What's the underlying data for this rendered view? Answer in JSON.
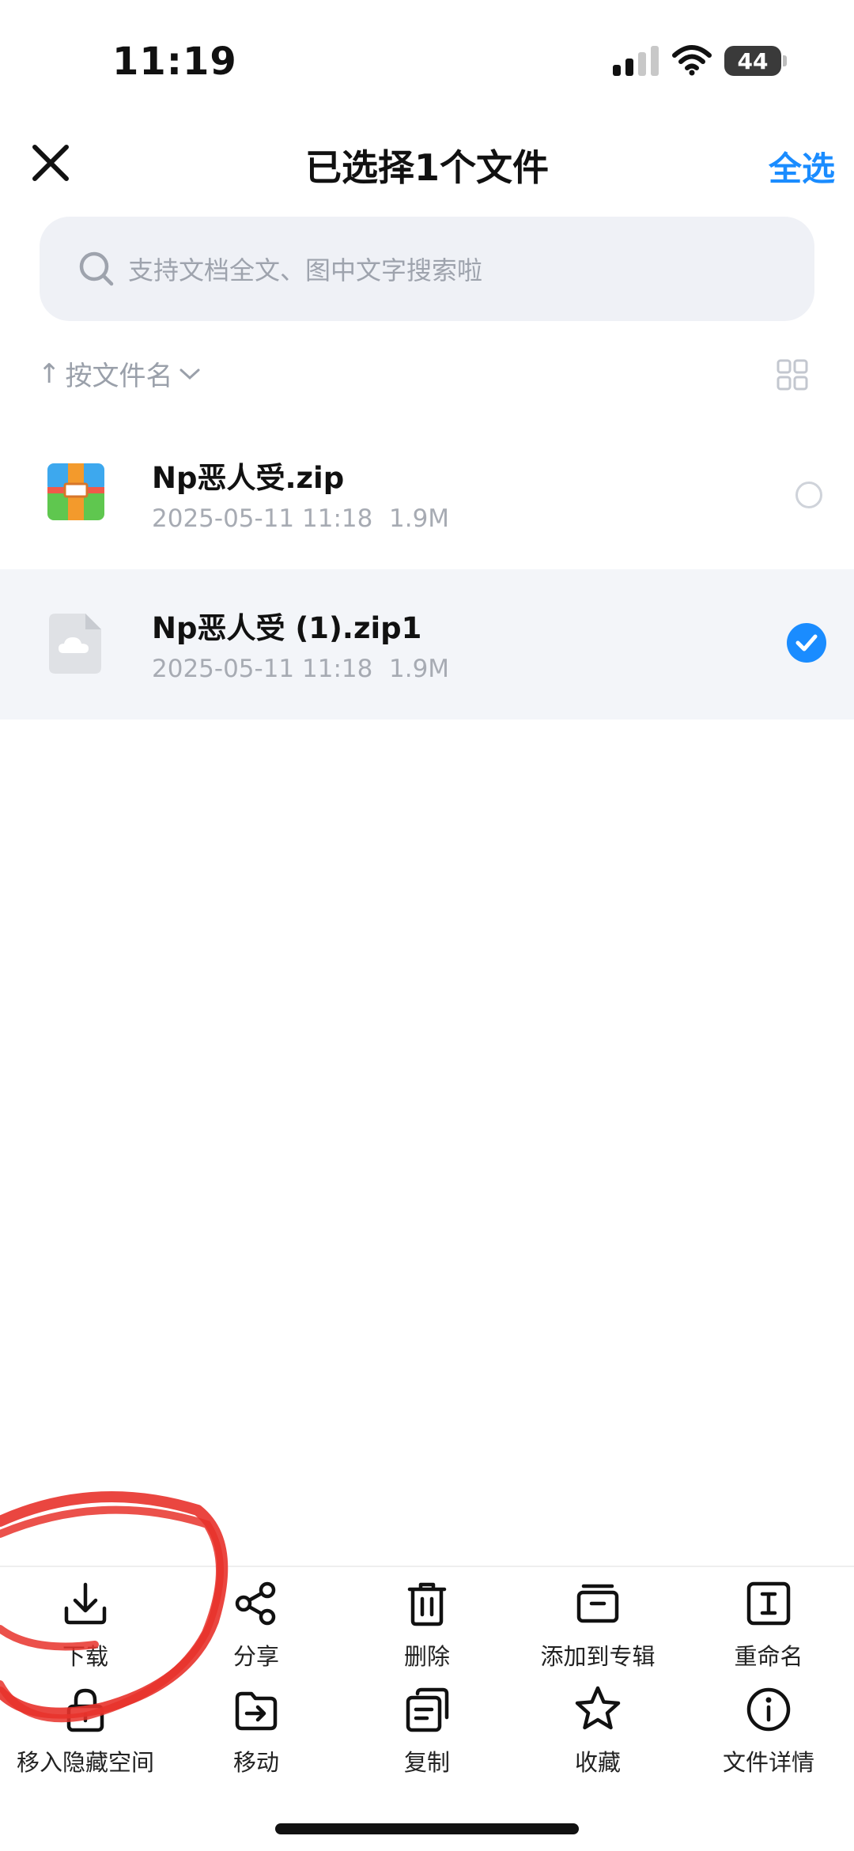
{
  "status_bar": {
    "time": "11:19",
    "battery": "44"
  },
  "header": {
    "title": "已选择1个文件",
    "select_all": "全选"
  },
  "search": {
    "placeholder": "支持文档全文、图中文字搜索啦"
  },
  "sort": {
    "label": "按文件名"
  },
  "files": [
    {
      "name": "Np恶人受.zip",
      "date": "2025-05-11 11:18",
      "size": "1.9M",
      "selected": false,
      "icon": "zip-archive-icon"
    },
    {
      "name": "Np恶人受 (1).zip1",
      "date": "2025-05-11 11:18",
      "size": "1.9M",
      "selected": true,
      "icon": "cloud-file-icon"
    }
  ],
  "actions_row1": [
    {
      "label": "下载",
      "icon": "download-icon"
    },
    {
      "label": "分享",
      "icon": "share-icon"
    },
    {
      "label": "删除",
      "icon": "trash-icon"
    },
    {
      "label": "添加到专辑",
      "icon": "album-icon"
    },
    {
      "label": "重命名",
      "icon": "rename-icon"
    }
  ],
  "actions_row2": [
    {
      "label": "移入隐藏空间",
      "icon": "lock-icon"
    },
    {
      "label": "移动",
      "icon": "move-icon"
    },
    {
      "label": "复制",
      "icon": "copy-icon"
    },
    {
      "label": "收藏",
      "icon": "star-icon"
    },
    {
      "label": "文件详情",
      "icon": "info-icon"
    }
  ],
  "colors": {
    "accent": "#1a8cff",
    "annotation": "#e8322b"
  }
}
